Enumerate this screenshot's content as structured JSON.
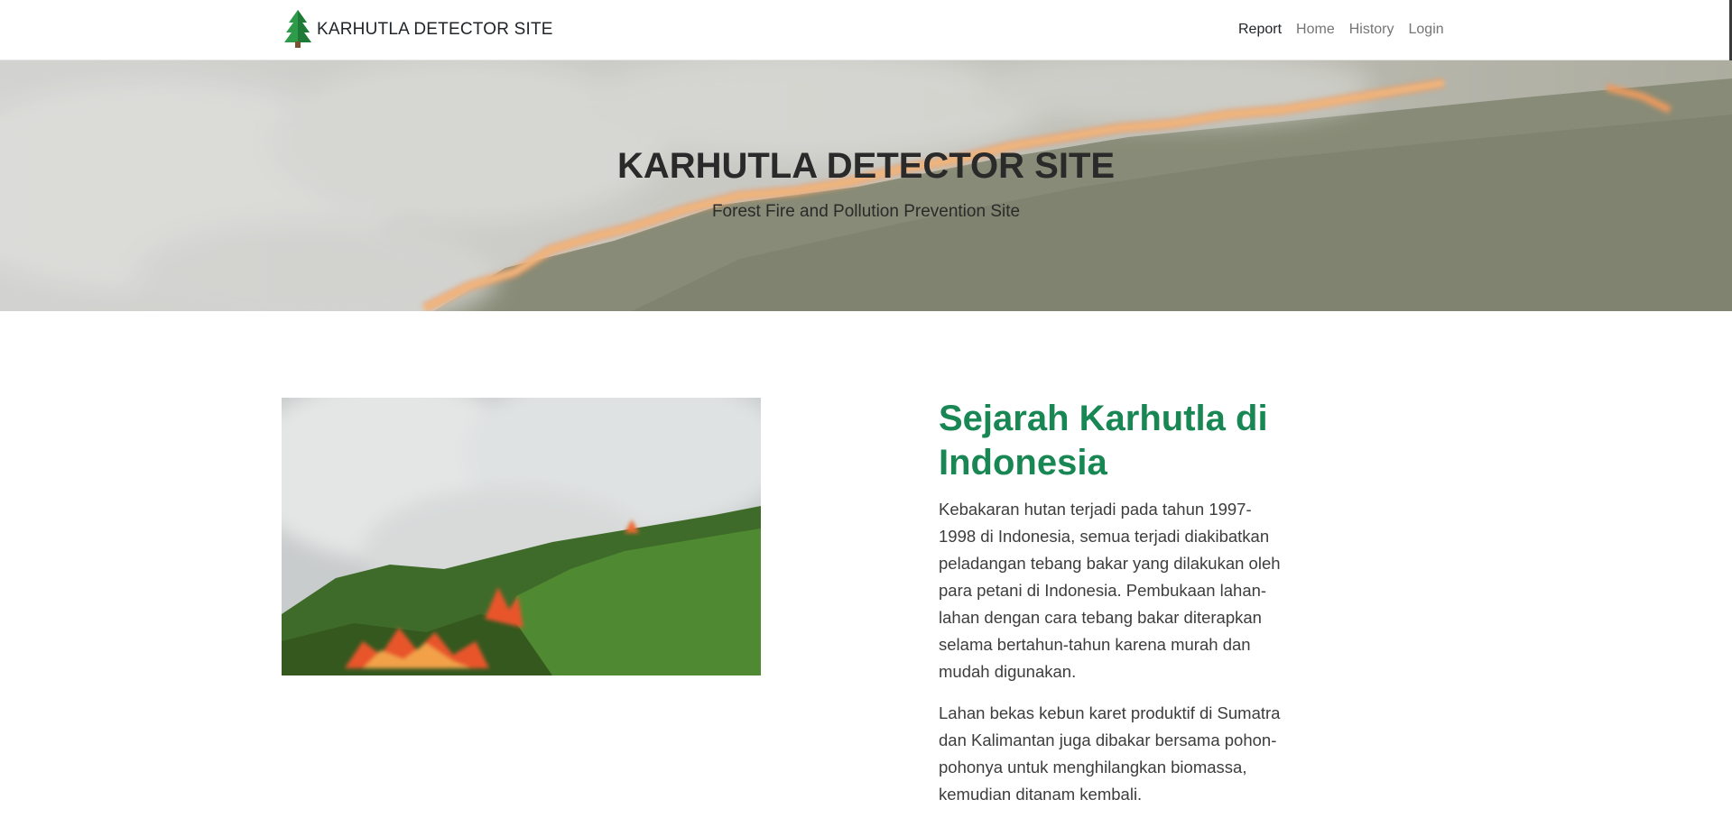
{
  "navbar": {
    "brand": "KARHUTLA DETECTOR SITE",
    "brand_icon": "pine-tree-icon",
    "links": [
      "Report",
      "Home",
      "History",
      "Login"
    ],
    "active_link": "Report"
  },
  "hero": {
    "title": "KARHUTLA DETECTOR SITE",
    "subtitle": "Forest Fire and Pollution Prevention Site"
  },
  "section": {
    "heading": "Sejarah Karhutla di Indonesia",
    "paragraphs": [
      "Kebakaran hutan terjadi pada tahun 1997-1998 di Indonesia, semua terjadi diakibatkan peladangan tebang bakar yang dilakukan oleh para petani di Indonesia. Pembukaan lahan-lahan dengan cara tebang bakar diterapkan selama bertahun-tahun karena murah dan mudah digunakan.",
      "Lahan bekas kebun karet produktif di Sumatra dan Kalimantan juga dibakar bersama pohon-pohonya untuk menghilangkan biomassa, kemudian ditanam kembali."
    ]
  },
  "colors": {
    "accent_green": "#198754",
    "text_dark": "#212529",
    "nav_muted": "#757575"
  }
}
